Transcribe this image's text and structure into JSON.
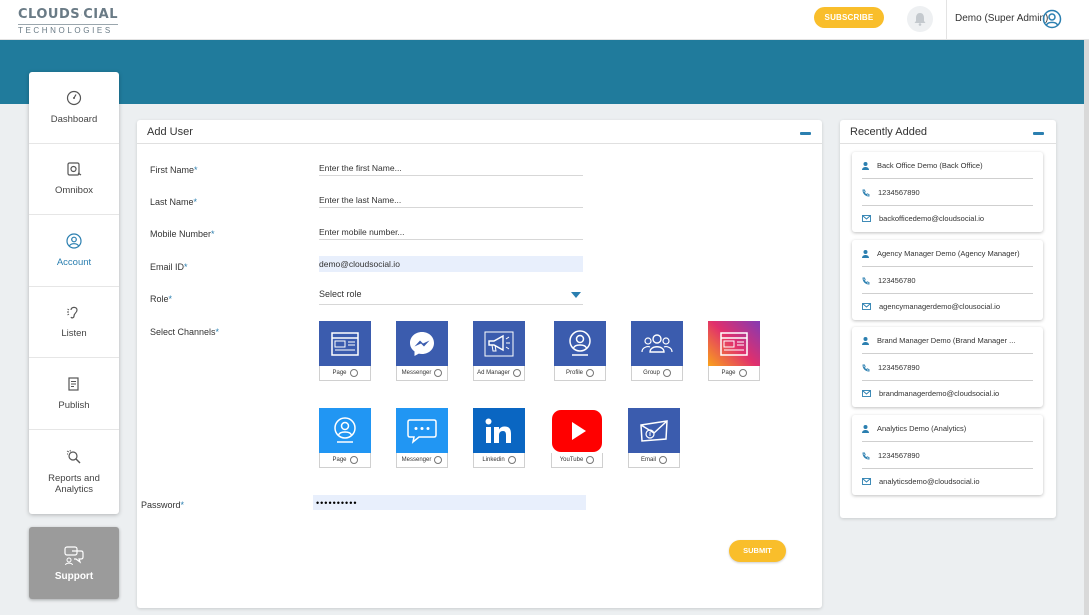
{
  "header": {
    "logo_main_left": "CLOUDS",
    "logo_main_right": "CIAL",
    "logo_sub": "TECHNOLOGIES",
    "subscribe_label": "SUBSCRIBE",
    "user_name": "Demo (Super Admin)"
  },
  "sidebar": {
    "items": [
      {
        "label": "Dashboard",
        "icon": "speedometer-icon"
      },
      {
        "label": "Omnibox",
        "icon": "inbox-icon"
      },
      {
        "label": "Account",
        "icon": "user-circle-icon",
        "active": true
      },
      {
        "label": "Listen",
        "icon": "ear-icon"
      },
      {
        "label": "Publish",
        "icon": "document-icon"
      },
      {
        "label": "Reports and Analytics",
        "icon": "analytics-search-icon"
      }
    ],
    "support_label": "Support"
  },
  "add_user": {
    "title": "Add User",
    "first_name_label": "First Name",
    "first_name_placeholder": "Enter the first Name...",
    "last_name_label": "Last Name",
    "last_name_placeholder": "Enter the last Name...",
    "mobile_label": "Mobile Number",
    "mobile_placeholder": "Enter mobile number...",
    "email_label": "Email ID",
    "email_value": "demo@cloudsocial.io",
    "role_label": "Role",
    "role_value": "Select role",
    "channels_label": "Select Channels",
    "channels": [
      {
        "caption": "Page",
        "icon": "facebook-page-icon",
        "color": "#3b5cae"
      },
      {
        "caption": "Messenger",
        "icon": "messenger-icon",
        "color": "#3b5cae"
      },
      {
        "caption": "Ad Manager",
        "icon": "megaphone-icon",
        "color": "#3b5cae"
      },
      {
        "caption": "Profile",
        "icon": "profile-icon",
        "color": "#3b5cae"
      },
      {
        "caption": "Group",
        "icon": "group-icon",
        "color": "#3b5cae"
      },
      {
        "caption": "Page",
        "icon": "instagram-page-icon",
        "color": "#d6297a"
      },
      {
        "caption": "Page",
        "icon": "twitter-page-icon",
        "color": "#2196f3"
      },
      {
        "caption": "Messenger",
        "icon": "chat-bubble-icon",
        "color": "#2196f3"
      },
      {
        "caption": "Linkedin",
        "icon": "linkedin-icon",
        "color": "#0a66c2"
      },
      {
        "caption": "YouTube",
        "icon": "youtube-icon",
        "color": "#ff0000"
      },
      {
        "caption": "Email",
        "icon": "email-icon",
        "color": "#3b5cae"
      }
    ],
    "password_label": "Password",
    "password_value": "••••••••••",
    "submit_label": "SUBMIT"
  },
  "recent": {
    "title": "Recently Added",
    "cards": [
      {
        "name": "Back Office Demo (Back Office)",
        "phone": "1234567890",
        "email": "backofficedemo@cloudsocial.io"
      },
      {
        "name": "Agency Manager Demo (Agency Manager)",
        "phone": "123456780",
        "email": "agencymanagerdemo@clousocial.io"
      },
      {
        "name": "Brand Manager Demo (Brand Manager ...",
        "phone": "1234567890",
        "email": "brandmanagerdemo@cloudsocial.io"
      },
      {
        "name": "Analytics Demo (Analytics)",
        "phone": "1234567890",
        "email": "analyticsdemo@cloudsocial.io"
      }
    ]
  },
  "colors": {
    "brand_teal": "#207b9c",
    "accent_blue": "#2b7fb0",
    "button_yellow": "#f9be2b"
  }
}
